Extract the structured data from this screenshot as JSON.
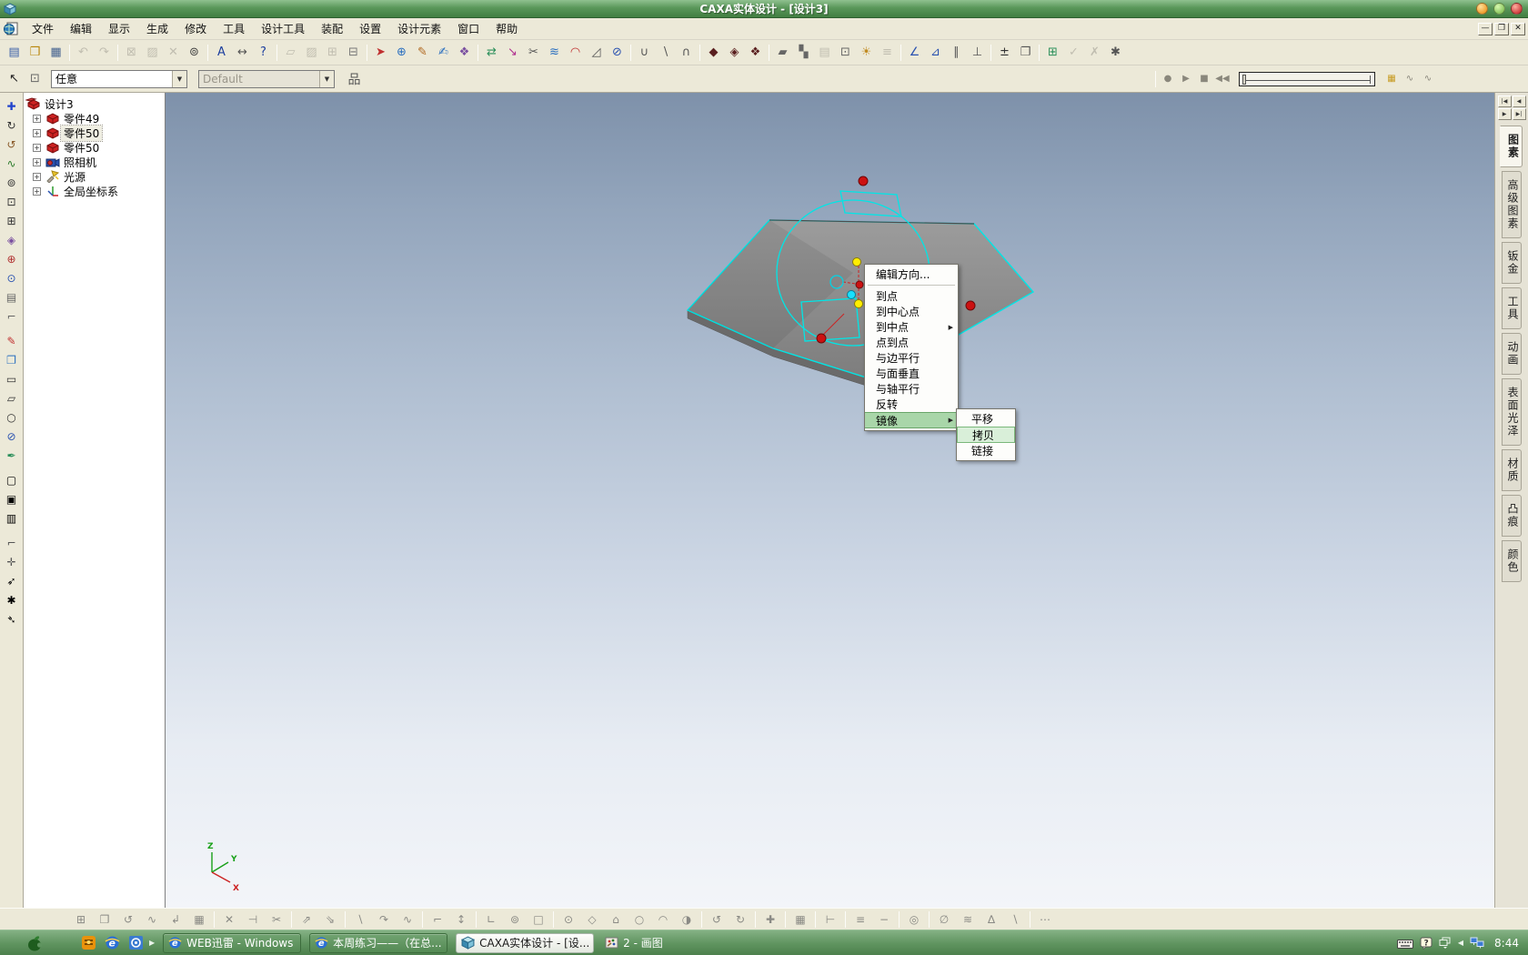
{
  "window": {
    "title": "CAXA实体设计 - [设计3]",
    "controls": {
      "minimize": "—",
      "restore": "❐",
      "close": "✕"
    }
  },
  "menu_bar": {
    "items": [
      "文件",
      "编辑",
      "显示",
      "生成",
      "修改",
      "工具",
      "设计工具",
      "装配",
      "设置",
      "设计元素",
      "窗口",
      "帮助"
    ]
  },
  "toolbar_main": {
    "icons": [
      {
        "n": "new-document",
        "g": "▤",
        "c": "#3a5fa8"
      },
      {
        "n": "open-file",
        "g": "❒",
        "c": "#b8860b"
      },
      {
        "n": "save-file",
        "g": "▦",
        "c": "#44628f"
      },
      {
        "n": "undo",
        "g": "↶",
        "d": 1,
        "s": 1
      },
      {
        "n": "redo",
        "g": "↷",
        "d": 1
      },
      {
        "n": "view-previous",
        "g": "⊠",
        "c": "#a0606a",
        "d": 1,
        "s": 1
      },
      {
        "n": "view-sheet",
        "g": "▨",
        "d": 1
      },
      {
        "n": "delete",
        "g": "✕",
        "d": 1
      },
      {
        "n": "zoom-search",
        "g": "⊚",
        "c": "#444"
      },
      {
        "n": "text-tool",
        "g": "A",
        "c": "#1d3f9e",
        "s": 1
      },
      {
        "n": "dimension-tool",
        "g": "↔",
        "c": "#555"
      },
      {
        "n": "context-help",
        "g": "?",
        "c": "#1d3f9e"
      },
      {
        "n": "sketch-plane",
        "g": "▱",
        "c": "#b08050",
        "d": 1,
        "s": 1
      },
      {
        "n": "surface-mode",
        "g": "▨",
        "c": "#888",
        "d": 1
      },
      {
        "n": "wireframe-mode",
        "g": "⊞",
        "c": "#888",
        "d": 1
      },
      {
        "n": "render-mode",
        "g": "⊟",
        "c": "#777"
      },
      {
        "n": "extrude-feature",
        "g": "➤",
        "c": "#c03030",
        "s": 1
      },
      {
        "n": "revolve-feature",
        "g": "⊕",
        "c": "#2a6fbf"
      },
      {
        "n": "sweep-feature",
        "g": "✎",
        "c": "#b06820"
      },
      {
        "n": "loft-feature",
        "g": "✍",
        "c": "#2a6fbf"
      },
      {
        "n": "pattern-feature",
        "g": "❖",
        "c": "#7a4fa0"
      },
      {
        "n": "mirror-feature",
        "g": "⇄",
        "c": "#2a8f5a",
        "s": 1
      },
      {
        "n": "scale-tool",
        "g": "↘",
        "c": "#b02f8f"
      },
      {
        "n": "trim-tool",
        "g": "✂",
        "c": "#555"
      },
      {
        "n": "offset-tool",
        "g": "≋",
        "c": "#2a6fbf"
      },
      {
        "n": "fillet-tool",
        "g": "◠",
        "c": "#c03030"
      },
      {
        "n": "chamfer-tool",
        "g": "◿",
        "c": "#555"
      },
      {
        "n": "shell-tool",
        "g": "⊘",
        "c": "#2a52b0"
      },
      {
        "n": "boolean-union",
        "g": "∪",
        "c": "#555",
        "s": 1
      },
      {
        "n": "boolean-subtract",
        "g": "∖",
        "c": "#555"
      },
      {
        "n": "boolean-intersect",
        "g": "∩",
        "c": "#555"
      },
      {
        "n": "render-dark",
        "g": "◆",
        "c": "#5a1f1f",
        "s": 1
      },
      {
        "n": "render-medium",
        "g": "◈",
        "c": "#5a1f1f"
      },
      {
        "n": "render-bright",
        "g": "❖",
        "c": "#5a1f1f"
      },
      {
        "n": "smart-render",
        "g": "▰",
        "c": "#666",
        "s": 1
      },
      {
        "n": "shadow-toggle",
        "g": "▚",
        "c": "#666"
      },
      {
        "n": "background-set",
        "g": "▤",
        "c": "#888",
        "d": 1
      },
      {
        "n": "camera-view",
        "g": "⊡",
        "c": "#666"
      },
      {
        "n": "spotlight",
        "g": "☀",
        "c": "#c08a20"
      },
      {
        "n": "fog-effect",
        "g": "≡",
        "c": "#888",
        "d": 1
      },
      {
        "n": "measure-distance",
        "g": "∠",
        "c": "#2a52b0",
        "s": 1
      },
      {
        "n": "measure-angle",
        "g": "⊿",
        "c": "#2a52b0"
      },
      {
        "n": "constraint-parallel",
        "g": "∥",
        "c": "#555"
      },
      {
        "n": "constraint-perpendicular",
        "g": "⊥",
        "c": "#555"
      },
      {
        "n": "precision-input",
        "g": "±",
        "c": "#333",
        "s": 1
      },
      {
        "n": "copy-sheet",
        "g": "❐",
        "c": "#555"
      },
      {
        "n": "part-library",
        "g": "⊞",
        "c": "#2a8f5a",
        "s": 1
      },
      {
        "n": "assembly-check",
        "g": "✓",
        "c": "#888",
        "d": 1
      },
      {
        "n": "interference-check",
        "g": "✗",
        "c": "#888",
        "d": 1
      },
      {
        "n": "settings-gear",
        "g": "✱",
        "c": "#555"
      }
    ]
  },
  "toolbar_second": {
    "left_icons": [
      {
        "n": "select-arrow",
        "g": "↖",
        "c": "#222"
      },
      {
        "n": "select-box",
        "g": "⊡",
        "c": "#666"
      }
    ],
    "selection_filter_value": "任意",
    "render_style_value": "Default",
    "scene_browser_glyph": "品",
    "playback_icons": [
      {
        "n": "record",
        "g": "●",
        "d": 1
      },
      {
        "n": "play",
        "g": "▶",
        "d": 1
      },
      {
        "n": "stop",
        "g": "■",
        "d": 1
      },
      {
        "n": "rewind",
        "g": "◀◀",
        "d": 1
      }
    ],
    "after_timeline_icons": [
      {
        "n": "new-animation",
        "g": "▦",
        "c": "#c79b22"
      },
      {
        "n": "edit-curve",
        "g": "∿",
        "d": 1
      },
      {
        "n": "edit-key-curve",
        "g": "∿",
        "d": 1
      }
    ]
  },
  "left_toolbar": {
    "icons": [
      {
        "n": "move-tool",
        "g": "✚",
        "c": "#2244cc"
      },
      {
        "n": "rotate-view",
        "g": "↻",
        "c": "#333"
      },
      {
        "n": "spin-tool",
        "g": "↺",
        "c": "#8a5a2a"
      },
      {
        "n": "curve-tool",
        "g": "∿",
        "c": "#2a7a2a"
      },
      {
        "n": "zoom-tool",
        "g": "⊚",
        "c": "#333"
      },
      {
        "n": "zoom-window",
        "g": "⊡",
        "c": "#333"
      },
      {
        "n": "zoom-fit",
        "g": "⊞",
        "c": "#333"
      },
      {
        "n": "view-orient",
        "g": "◈",
        "c": "#7a4fa0"
      },
      {
        "n": "target-view",
        "g": "⊕",
        "c": "#b02f2f"
      },
      {
        "n": "camera-tool",
        "g": "⊙",
        "c": "#2a52b0"
      },
      {
        "n": "display-list",
        "g": "▤",
        "c": "#666"
      },
      {
        "n": "command-tool",
        "g": "⌐",
        "c": "#666"
      },
      {
        "n": "edit-sketch",
        "g": "✎",
        "c": "#c03030",
        "s": 1
      },
      {
        "n": "new-sketch",
        "g": "❐",
        "c": "#2a6fbf"
      },
      {
        "n": "rect-sketch",
        "g": "▭",
        "c": "#333"
      },
      {
        "n": "poly-sketch",
        "g": "▱",
        "c": "#333"
      },
      {
        "n": "circle-sketch",
        "g": "○",
        "c": "#333"
      },
      {
        "n": "ellipse-sketch",
        "g": "⊘",
        "c": "#2a52b0"
      },
      {
        "n": "spline-sketch",
        "g": "✒",
        "c": "#2a8f5a"
      },
      {
        "n": "surface-gray",
        "g": "▢",
        "c": "#999",
        "d": 1,
        "s": 1
      },
      {
        "n": "solid-gray",
        "g": "▣",
        "c": "#999",
        "d": 1
      },
      {
        "n": "mesh-gray",
        "g": "▥",
        "c": "#999",
        "d": 1
      },
      {
        "n": "corner-tool",
        "g": "⌐",
        "c": "#555",
        "s": 1
      },
      {
        "n": "cross-tool",
        "g": "✛",
        "c": "#555"
      },
      {
        "n": "arrow-ne-tool",
        "g": "➶",
        "c": "#888",
        "d": 1
      },
      {
        "n": "asterisk-tool",
        "g": "✱",
        "c": "#888",
        "d": 1
      },
      {
        "n": "arrow-se-tool",
        "g": "➴",
        "c": "#888",
        "d": 1
      }
    ]
  },
  "scene_tree": {
    "root": {
      "label": "设计3",
      "type": "design"
    },
    "nodes": [
      {
        "label": "零件49",
        "type": "part"
      },
      {
        "label": "零件50",
        "type": "part",
        "selected": true
      },
      {
        "label": "零件50",
        "type": "part"
      },
      {
        "label": "照相机",
        "type": "camera"
      },
      {
        "label": "光源",
        "type": "light"
      },
      {
        "label": "全局坐标系",
        "type": "axes"
      }
    ],
    "expander_glyph": "+"
  },
  "context_menu": {
    "items": [
      {
        "label": "编辑方向..."
      },
      {
        "sep": true
      },
      {
        "label": "到点"
      },
      {
        "label": "到中心点"
      },
      {
        "label": "到中点",
        "arrow": true
      },
      {
        "label": "点到点"
      },
      {
        "label": "与边平行"
      },
      {
        "label": "与面垂直"
      },
      {
        "label": "与轴平行"
      },
      {
        "label": "反转"
      },
      {
        "label": "镜像",
        "arrow": true,
        "highlight": true
      }
    ],
    "submenu": {
      "items": [
        {
          "label": "平移"
        },
        {
          "label": "拷贝",
          "highlight": true
        },
        {
          "label": "链接"
        }
      ]
    }
  },
  "right_tabs": {
    "nav_buttons": [
      "|◀",
      "◀",
      "▶",
      "▶|"
    ],
    "tabs": [
      "图素",
      "高级图素",
      "钣金",
      "工具",
      "动画",
      "表面光泽",
      "材质",
      "凸痕",
      "颜色"
    ],
    "active": "图素"
  },
  "bottom_toolbar": {
    "icons": [
      {
        "n": "align-2d",
        "g": "⊞"
      },
      {
        "n": "stretch-2d",
        "g": "❐"
      },
      {
        "n": "rotate-2d",
        "g": "↺"
      },
      {
        "n": "offset-2d",
        "g": "∿"
      },
      {
        "n": "mirror-2d",
        "g": "↲"
      },
      {
        "n": "print-2d",
        "g": "▦"
      },
      {
        "n": "erase-2d",
        "g": "✕",
        "s": 1
      },
      {
        "n": "break-2d",
        "g": "⊣"
      },
      {
        "n": "trim-2d",
        "g": "✂"
      },
      {
        "n": "copy-2d",
        "g": "⇗",
        "s": 1
      },
      {
        "n": "move-2d",
        "g": "⇘"
      },
      {
        "n": "line-2d",
        "g": "∖",
        "s": 1
      },
      {
        "n": "arc-2d",
        "g": "↷"
      },
      {
        "n": "spline-2d",
        "g": "∿"
      },
      {
        "n": "corner-2d",
        "g": "⌐",
        "s": 1
      },
      {
        "n": "vertical-dim",
        "g": "↕"
      },
      {
        "n": "angle-dim",
        "g": "∟",
        "s": 1
      },
      {
        "n": "circle-dim",
        "g": "⊚"
      },
      {
        "n": "rect-tool-2d",
        "g": "□"
      },
      {
        "n": "center-circle",
        "g": "⊙",
        "s": 1
      },
      {
        "n": "diamond-2d",
        "g": "◇"
      },
      {
        "n": "home-view",
        "g": "⌂"
      },
      {
        "n": "circle-tool-2d",
        "g": "○"
      },
      {
        "n": "halfarc-2d",
        "g": "◠"
      },
      {
        "n": "pie-2d",
        "g": "◑"
      },
      {
        "n": "rotate-ccw-2d",
        "g": "↺",
        "s": 1
      },
      {
        "n": "rotate-cw-2d",
        "g": "↻"
      },
      {
        "n": "plus-2d",
        "g": "✚",
        "s": 1
      },
      {
        "n": "grid-2d",
        "g": "▦",
        "s": 1
      },
      {
        "n": "tee-2d",
        "g": "⊢",
        "s": 1
      },
      {
        "n": "equal-2d",
        "g": "≡",
        "s": 1
      },
      {
        "n": "minus-2d",
        "g": "−"
      },
      {
        "n": "target-2d",
        "g": "◎",
        "s": 1
      },
      {
        "n": "null-2d",
        "g": "∅",
        "s": 1
      },
      {
        "n": "waves-2d",
        "g": "≋"
      },
      {
        "n": "delta-2d",
        "g": "∆"
      },
      {
        "n": "slash-2d",
        "g": "∖"
      },
      {
        "n": "more-2d",
        "g": "⋯",
        "s": 1
      }
    ]
  },
  "viewport": {
    "axis_labels": {
      "x": "X",
      "y": "Y",
      "z": "Z"
    }
  },
  "taskbar": {
    "quick_launch": [
      {
        "name": "antivirus"
      },
      {
        "name": "internet-explorer"
      },
      {
        "name": "messenger"
      }
    ],
    "windows": [
      {
        "label": "WEB迅雷 - Windows I...",
        "icon": "ie"
      },
      {
        "label": "本周练习——（在总...",
        "icon": "ie"
      },
      {
        "label": "CAXA实体设计 - [设...",
        "icon": "caxa",
        "active": true
      },
      {
        "label": "2 - 画图",
        "icon": "paint",
        "flat": true
      }
    ],
    "clock": "8:44"
  },
  "colors": {
    "titlebar_green": "#5a975a",
    "taskbar_green": "#5f945f",
    "menu_highlight_green": "#a9d6a9",
    "selection_cyan": "#00e6e6",
    "handle_red": "#cc1111",
    "handle_yellow": "#ffee00"
  }
}
